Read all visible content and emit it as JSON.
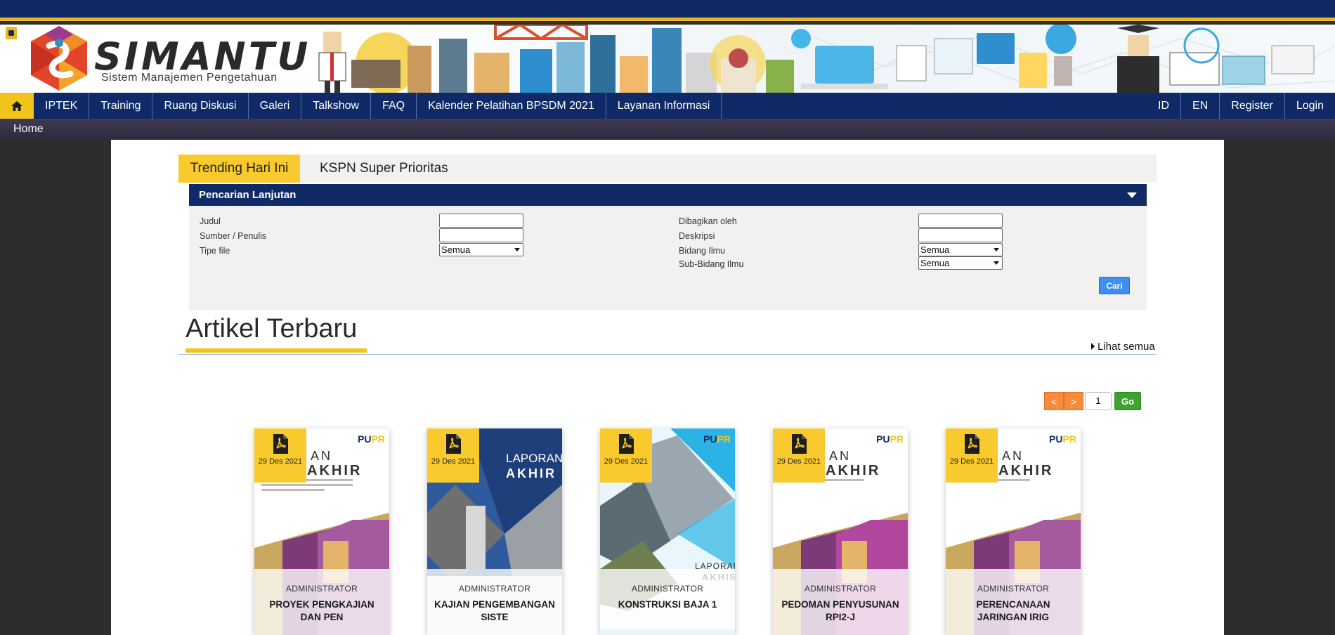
{
  "brand": {
    "title": "SIMANTU",
    "subtitle": "Sistem Manajemen Pengetahuan"
  },
  "nav": {
    "items": [
      "IPTEK",
      "Training",
      "Ruang Diskusi",
      "Galeri",
      "Talkshow",
      "FAQ",
      "Kalender Pelatihan BPSDM 2021",
      "Layanan Informasi"
    ],
    "right": [
      "ID",
      "EN",
      "Register",
      "Login"
    ]
  },
  "breadcrumb": "Home",
  "tabs": [
    "Trending Hari Ini",
    "KSPN Super Prioritas"
  ],
  "search": {
    "header": "Pencarian Lanjutan",
    "labels": {
      "judul": "Judul",
      "sumber": "Sumber / Penulis",
      "tipe": "Tipe file",
      "dibagikan": "Dibagikan oleh",
      "deskripsi": "Deskripsi",
      "bidang": "Bidang Ilmu",
      "subbidang": "Sub-Bidang Ilmu"
    },
    "tipe_value": "Semua",
    "bidang_value": "Semua",
    "subbidang_value": "Semua",
    "button": "Cari"
  },
  "section": {
    "title": "Artikel Terbaru",
    "see_all": "Lihat semua"
  },
  "pager": {
    "prev": "<",
    "next": ">",
    "page": "1",
    "go": "Go"
  },
  "cards": [
    {
      "date": "29 Des 2021",
      "author": "ADMINISTRATOR",
      "title": "PROYEK PENGKAJIAN DAN PEN"
    },
    {
      "date": "29 Des 2021",
      "author": "ADMINISTRATOR",
      "title": "KAJIAN PENGEMBANGAN SISTE"
    },
    {
      "date": "29 Des 2021",
      "author": "ADMINISTRATOR",
      "title": "KONSTRUKSI BAJA 1"
    },
    {
      "date": "29 Des 2021",
      "author": "ADMINISTRATOR",
      "title": "PEDOMAN PENYUSUNAN RPI2-J"
    },
    {
      "date": "29 Des 2021",
      "author": "ADMINISTRATOR",
      "title": "PERENCANAAN JARINGAN IRIG"
    }
  ],
  "colors": {
    "navy": "#0f2a66",
    "yellow": "#f8ca2d",
    "orange": "#f68b3c",
    "green": "#3fa22f",
    "blue_button": "#3f8ef0"
  }
}
